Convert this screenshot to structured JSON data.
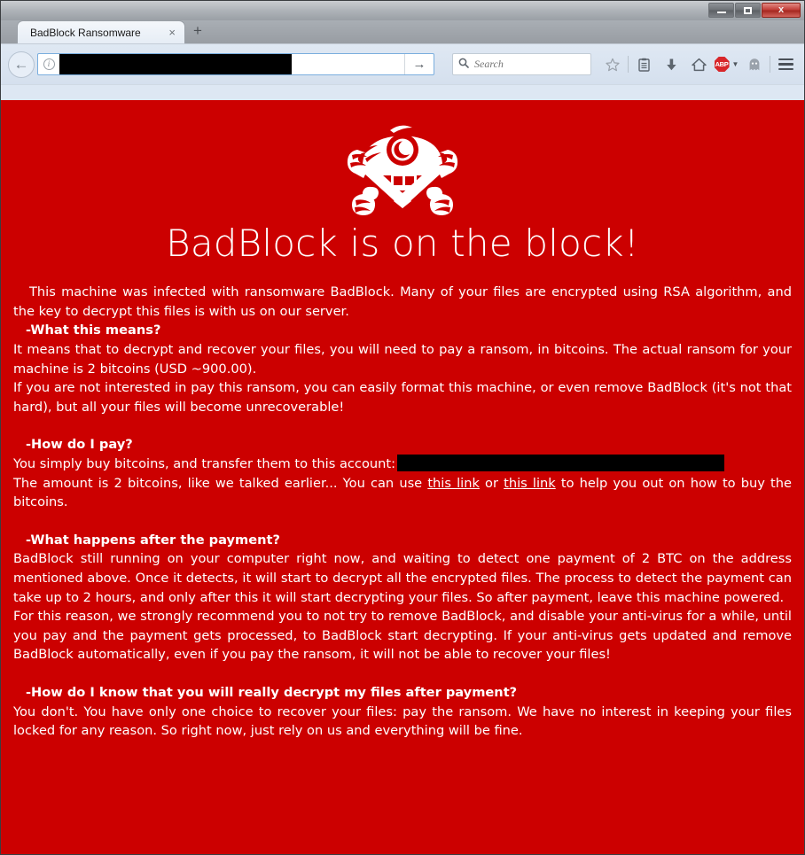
{
  "window": {
    "controls": {
      "minimize_label": "Minimize",
      "maximize_label": "Maximize",
      "close_label": "x"
    }
  },
  "browser": {
    "tab": {
      "title": "BadBlock Ransomware",
      "close_label": "×"
    },
    "new_tab_label": "+",
    "back_label": "←",
    "url": {
      "value": "",
      "redacted": true,
      "go_label": "→",
      "info_label": "i"
    },
    "search": {
      "placeholder": "Search",
      "value": "",
      "icon": "search-icon"
    },
    "toolbar_icons": [
      {
        "name": "bookmark-star-icon",
        "glyph": "☆"
      },
      {
        "name": "reading-list-icon",
        "glyph": "☷"
      },
      {
        "name": "downloads-icon",
        "glyph": "↓"
      },
      {
        "name": "home-icon",
        "glyph": "⌂"
      },
      {
        "name": "adblock-plus-icon",
        "glyph": "ABP"
      },
      {
        "name": "ghostery-icon",
        "glyph": "◑"
      },
      {
        "name": "menu-icon",
        "glyph": "≡"
      }
    ]
  },
  "page": {
    "background_color": "#cc0000",
    "text_color": "#ffffff",
    "logo_name": "badblock-monster-logo",
    "title": "BadBlock is on the block!",
    "intro": "This machine was infected with ransomware BadBlock. Many of your files are encrypted using RSA algorithm, and the key to decrypt this files is with us on our server.",
    "sections": [
      {
        "heading": "-What this means?",
        "paragraphs": [
          "It means that to decrypt and recover your files, you will need to pay a ransom, in bitcoins. The actual ransom for your machine is 2 bitcoins (USD ~900.00).",
          "If you are not interested in pay this ransom, you can easily format this machine, or even remove BadBlock (it's not that hard), but all your files will become unrecoverable!"
        ]
      },
      {
        "heading": "-How do I pay?",
        "paragraphs": []
      },
      {
        "heading": "-What happens after the payment?",
        "paragraphs": [
          "BadBlock still running on your computer right now, and waiting to detect one payment of 2 BTC on the address mentioned above. Once it detects, it will start to decrypt all the encrypted files. The process to detect the payment can take up to 2 hours, and only after this it will start decrypting your files. So after payment, leave this machine powered.",
          "For this reason, we strongly recommend you to not try to remove BadBlock, and disable your anti-virus for a while, until you pay and the payment gets processed, to BadBlock start decrypting. If your anti-virus gets updated and remove BadBlock automatically, even if you pay the ransom, it will not be able to recover your files!"
        ]
      },
      {
        "heading": "-How do I know that you will really decrypt my files after payment?",
        "paragraphs": [
          "You don't. You have only one choice to recover your files: pay the ransom. We have no interest in keeping your files locked for any reason. So right now, just rely on us and everything will be fine."
        ]
      }
    ],
    "pay": {
      "account_prefix": "You simply buy bitcoins, and transfer them to this account:",
      "account_redacted": true,
      "amount_line_a": "The amount is 2 bitcoins, like we talked earlier... You can use ",
      "link_one": "this link",
      "amount_line_mid": " or ",
      "link_two": "this link",
      "amount_line_b": " to help you out on how to buy the bitcoins."
    }
  }
}
